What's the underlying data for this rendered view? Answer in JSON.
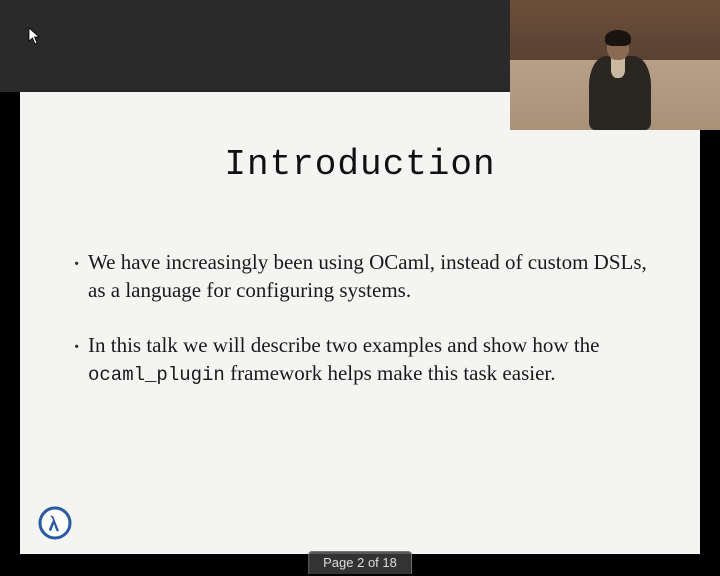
{
  "slide": {
    "title": "Introduction",
    "bullets": [
      {
        "pre": "We have increasingly been using OCaml, instead of custom DSLs, as a language for configuring systems.",
        "code": "",
        "post": ""
      },
      {
        "pre": "In this talk we will describe two examples and show how the ",
        "code": "ocaml_plugin",
        "post": " framework helps make this task easier."
      }
    ]
  },
  "page_indicator": "Page 2 of 18",
  "logo_name": "lambda-logo",
  "colors": {
    "slide_bg": "#f4f4f2",
    "top_bar": "#2a2a2a",
    "logo_stroke": "#2a5aa0"
  }
}
